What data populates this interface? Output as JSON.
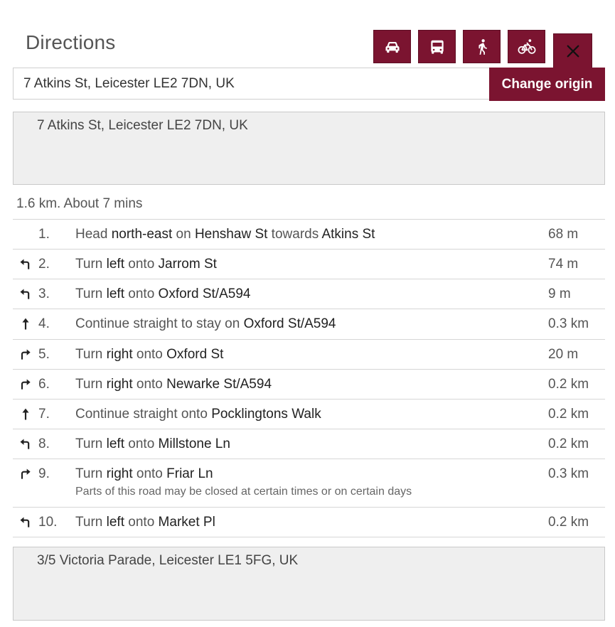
{
  "panel": {
    "title": "Directions"
  },
  "modes": [
    {
      "name": "car-mode-button",
      "icon": "car-icon"
    },
    {
      "name": "bus-mode-button",
      "icon": "bus-icon"
    },
    {
      "name": "walk-mode-button",
      "icon": "walk-icon"
    },
    {
      "name": "bike-mode-button",
      "icon": "bicycle-icon"
    }
  ],
  "close": {
    "icon": "close-icon"
  },
  "origin": {
    "value": "7 Atkins St, Leicester LE2 7DN, UK",
    "change_label": "Change origin"
  },
  "start_address": "7 Atkins St, Leicester LE2 7DN, UK",
  "summary": "1.6 km. About 7 mins",
  "steps": [
    {
      "num": "1.",
      "icon": "",
      "parts": [
        [
          "Head ",
          false
        ],
        [
          "north-east",
          true
        ],
        [
          " on ",
          false
        ],
        [
          "Henshaw St",
          true
        ],
        [
          " towards ",
          false
        ],
        [
          "Atkins St",
          true
        ]
      ],
      "distance": "68 m",
      "note": ""
    },
    {
      "num": "2.",
      "icon": "turn-left-icon",
      "parts": [
        [
          "Turn ",
          false
        ],
        [
          "left",
          true
        ],
        [
          " onto ",
          false
        ],
        [
          "Jarrom St",
          true
        ]
      ],
      "distance": "74 m",
      "note": ""
    },
    {
      "num": "3.",
      "icon": "turn-left-icon",
      "parts": [
        [
          "Turn ",
          false
        ],
        [
          "left",
          true
        ],
        [
          " onto ",
          false
        ],
        [
          "Oxford St/A594",
          true
        ]
      ],
      "distance": "9 m",
      "note": ""
    },
    {
      "num": "4.",
      "icon": "straight-icon",
      "parts": [
        [
          "Continue straight to stay on ",
          false
        ],
        [
          "Oxford St/A594",
          true
        ]
      ],
      "distance": "0.3 km",
      "note": ""
    },
    {
      "num": "5.",
      "icon": "turn-right-icon",
      "parts": [
        [
          "Turn ",
          false
        ],
        [
          "right",
          true
        ],
        [
          " onto ",
          false
        ],
        [
          "Oxford St",
          true
        ]
      ],
      "distance": "20 m",
      "note": ""
    },
    {
      "num": "6.",
      "icon": "turn-right-icon",
      "parts": [
        [
          "Turn ",
          false
        ],
        [
          "right",
          true
        ],
        [
          " onto ",
          false
        ],
        [
          "Newarke St/A594",
          true
        ]
      ],
      "distance": "0.2 km",
      "note": ""
    },
    {
      "num": "7.",
      "icon": "straight-icon",
      "parts": [
        [
          "Continue straight onto ",
          false
        ],
        [
          "Pocklingtons Walk",
          true
        ]
      ],
      "distance": "0.2 km",
      "note": ""
    },
    {
      "num": "8.",
      "icon": "turn-left-icon",
      "parts": [
        [
          "Turn ",
          false
        ],
        [
          "left",
          true
        ],
        [
          " onto ",
          false
        ],
        [
          "Millstone Ln",
          true
        ]
      ],
      "distance": "0.2 km",
      "note": ""
    },
    {
      "num": "9.",
      "icon": "turn-right-icon",
      "parts": [
        [
          "Turn ",
          false
        ],
        [
          "right",
          true
        ],
        [
          " onto ",
          false
        ],
        [
          "Friar Ln",
          true
        ]
      ],
      "distance": "0.3 km",
      "note": "Parts of this road may be closed at certain times or on certain days"
    },
    {
      "num": "10.",
      "icon": "turn-left-icon",
      "parts": [
        [
          "Turn ",
          false
        ],
        [
          "left",
          true
        ],
        [
          " onto ",
          false
        ],
        [
          "Market Pl",
          true
        ]
      ],
      "distance": "0.2 km",
      "note": ""
    }
  ],
  "end_address": "3/5 Victoria Parade, Leicester LE1 5FG, UK",
  "colors": {
    "accent": "#7b1430",
    "box_bg": "#efefef"
  }
}
